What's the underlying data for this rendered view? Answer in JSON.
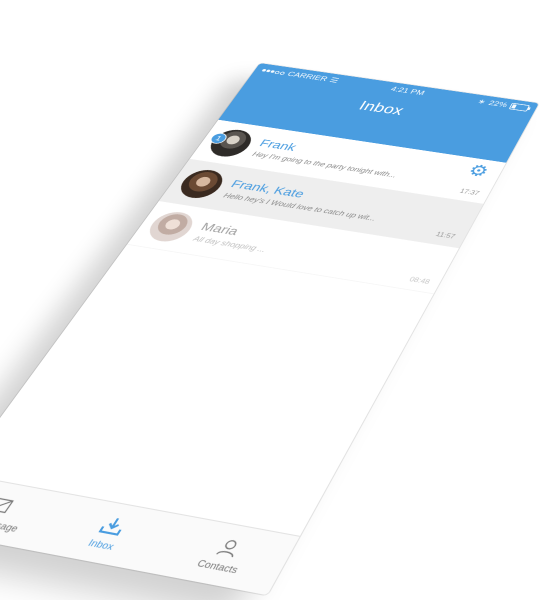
{
  "status_bar": {
    "carrier": "CARRIER",
    "time": "4:21 PM",
    "battery": "22%"
  },
  "header": {
    "title": "Inbox",
    "settings_icon": "gear-icon",
    "color": "#4a9de0"
  },
  "conversations": [
    {
      "name": "Frank",
      "preview": "Hey I'm going to the party tonight with...",
      "time": "17:37",
      "unread": "1",
      "selected": false
    },
    {
      "name": "Frank, Kate",
      "preview": "Hello hey's I Would love to catch up wit...",
      "time": "11:57",
      "selected": true
    },
    {
      "name": "Maria",
      "preview": "All day shopping ...",
      "time": "08:48",
      "selected": false
    }
  ],
  "tabbar": {
    "tabs": [
      {
        "label": "New Message",
        "icon": "envelope-icon",
        "active": false
      },
      {
        "label": "Inbox",
        "icon": "inbox-download-icon",
        "active": true
      },
      {
        "label": "Contacts",
        "icon": "person-icon",
        "active": false
      }
    ]
  }
}
